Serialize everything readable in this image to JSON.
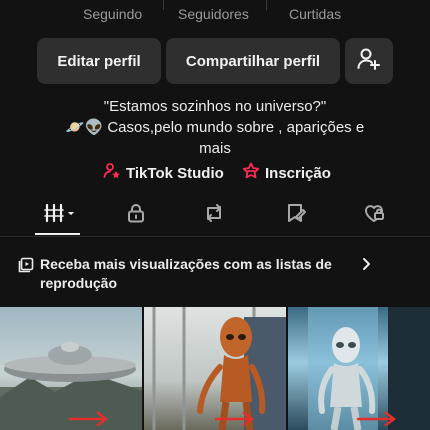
{
  "stats": {
    "following_label": "Seguindo",
    "followers_label": "Seguidores",
    "likes_label": "Curtidas"
  },
  "buttons": {
    "edit_profile": "Editar perfil",
    "share_profile": "Compartilhar perfil",
    "add_friend_icon": "add-user-icon"
  },
  "bio": {
    "line1": "\"Estamos sozinhos no universo?\"",
    "line2": "🪐👽 Casos,pelo mundo sobre , aparições e",
    "line3": "mais"
  },
  "links": {
    "studio_label": "TikTok Studio",
    "subscription_label": "Inscrição",
    "accent": "#fe2c55"
  },
  "tabs": [
    {
      "name": "videos-grid",
      "icon": "grid-icon",
      "active": true
    },
    {
      "name": "private",
      "icon": "lock-icon",
      "active": false
    },
    {
      "name": "reposts",
      "icon": "repost-icon",
      "active": false
    },
    {
      "name": "favorites",
      "icon": "bookmark-icon",
      "active": false
    },
    {
      "name": "liked",
      "icon": "heart-icon",
      "active": false
    }
  ],
  "banner": {
    "text": "Receba mais visualizações com as listas de reprodução"
  },
  "videos": [
    {
      "subject": "flying saucer over misty landscape"
    },
    {
      "subject": "orange alien figure standing in facility"
    },
    {
      "subject": "pale alien in glass tube laboratory"
    }
  ]
}
